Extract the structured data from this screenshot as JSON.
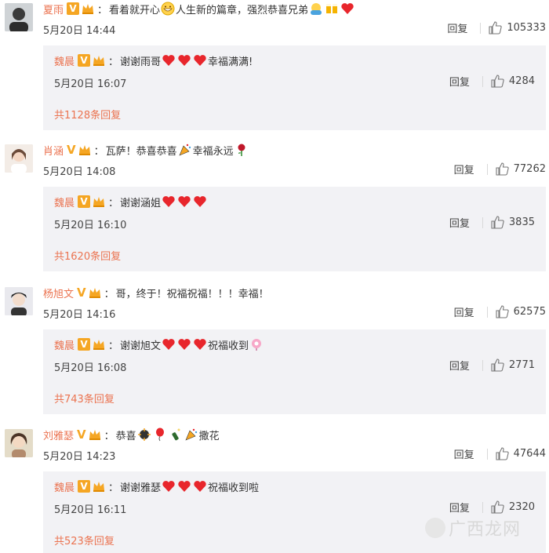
{
  "comments": [
    {
      "user": "夏雨",
      "text_a": "看着就开心",
      "text_b": "人生新的篇章，强烈恭喜兄弟",
      "date": "5月20日 14:44",
      "reply_label": "回复",
      "likes": "105333",
      "reply": {
        "user": "魏晨",
        "text": "谢谢雨哥",
        "text_after": "幸福满满!",
        "date": "5月20日 16:07",
        "reply_label": "回复",
        "likes": "4284",
        "count": "共1128条回复"
      }
    },
    {
      "user": "肖涵",
      "text_a": "瓦萨！恭喜恭喜",
      "text_b": "幸福永远",
      "date": "5月20日 14:08",
      "reply_label": "回复",
      "likes": "77262",
      "reply": {
        "user": "魏晨",
        "text": "谢谢涵姐",
        "text_after": "",
        "date": "5月20日 16:10",
        "reply_label": "回复",
        "likes": "3835",
        "count": "共1620条回复"
      }
    },
    {
      "user": "杨旭文",
      "text_a": "哥，终于！祝福祝福！！！幸福！",
      "text_b": "",
      "date": "5月20日 14:16",
      "reply_label": "回复",
      "likes": "62575",
      "reply": {
        "user": "魏晨",
        "text": "谢谢旭文",
        "text_after": "祝福收到",
        "date": "5月20日 16:08",
        "reply_label": "回复",
        "likes": "2771",
        "count": "共743条回复"
      }
    },
    {
      "user": "刘雅瑟",
      "text_a": "恭喜",
      "text_b": "撒花",
      "date": "5月20日 14:23",
      "reply_label": "回复",
      "likes": "47644",
      "reply": {
        "user": "魏晨",
        "text": "谢谢雅瑟",
        "text_after": "祝福收到啦",
        "date": "5月20日 16:11",
        "reply_label": "回复",
        "likes": "2320",
        "count": "共523条回复"
      }
    }
  ],
  "badges": {
    "verified": "V"
  },
  "watermark": {
    "text": "广西龙网"
  },
  "colors": {
    "username": "#eb7350",
    "reply_bg": "#f2f2f5",
    "verified": "#f5a623",
    "heart": "#e8262c"
  }
}
